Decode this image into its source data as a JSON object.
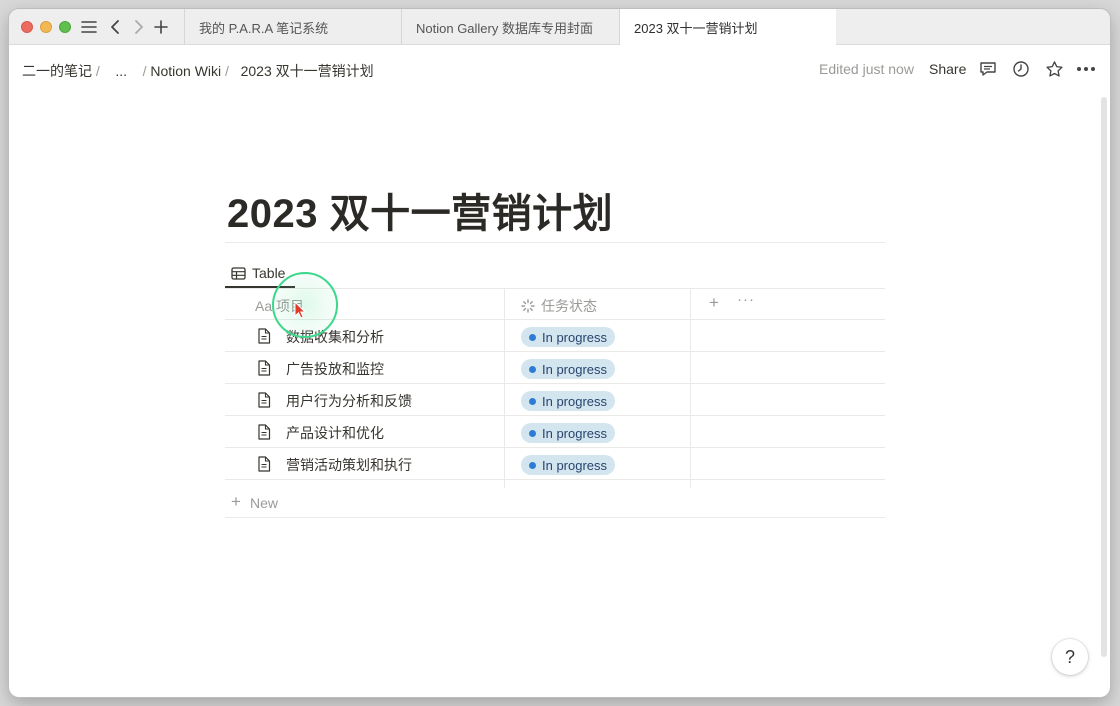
{
  "tabs": [
    {
      "label": "我的 P.A.R.A 笔记系统",
      "active": false
    },
    {
      "label": "Notion Gallery 数据库专用封面",
      "active": false
    },
    {
      "label": "2023 双十一营销计划",
      "active": true
    }
  ],
  "breadcrumb": {
    "items": [
      "二一的笔记",
      "...",
      "Notion Wiki",
      "2023 双十一营销计划"
    ],
    "separator": "/"
  },
  "topbar": {
    "edited": "Edited just now",
    "share": "Share"
  },
  "page": {
    "title": "2023 双十一营销计划"
  },
  "database": {
    "view_label": "Table",
    "columns": [
      {
        "prefix": "Aa",
        "label": "项目"
      },
      {
        "label": "任务状态"
      }
    ],
    "rows": [
      {
        "name": "数据收集和分析",
        "status": "In progress"
      },
      {
        "name": "广告投放和监控",
        "status": "In progress"
      },
      {
        "name": "用户行为分析和反馈",
        "status": "In progress"
      },
      {
        "name": "产品设计和优化",
        "status": "In progress"
      },
      {
        "name": "营销活动策划和执行",
        "status": "In progress"
      }
    ],
    "new_label": "New"
  },
  "help": {
    "label": "?"
  },
  "colors": {
    "status_bg": "#d3e5ef",
    "status_dot": "#2e7bd6",
    "status_text": "#28456c"
  }
}
